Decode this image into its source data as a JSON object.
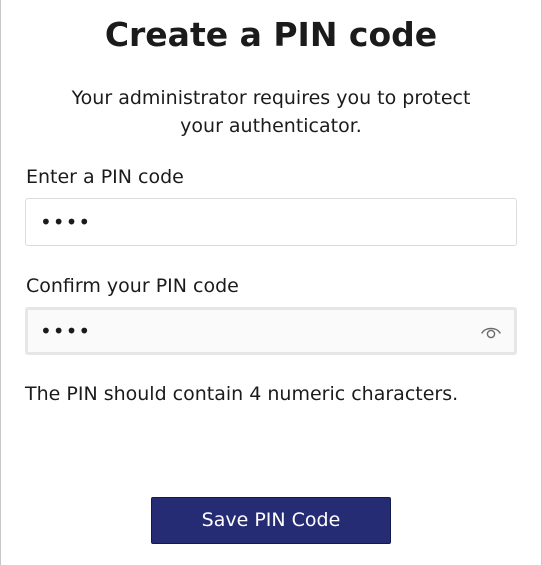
{
  "dialog": {
    "title": "Create a PIN code",
    "subtitle": "Your administrator requires you to protect your authenticator."
  },
  "pin_field": {
    "label": "Enter a PIN code",
    "value": "••••"
  },
  "confirm_field": {
    "label": "Confirm your PIN code",
    "value": "••••",
    "reveal_icon": "eye-icon"
  },
  "hint": "The PIN should contain 4 numeric characters.",
  "save_button": {
    "label": "Save PIN Code"
  },
  "colors": {
    "button_background": "#262c74",
    "button_text": "#ffffff",
    "text": "#1b1b1b"
  }
}
